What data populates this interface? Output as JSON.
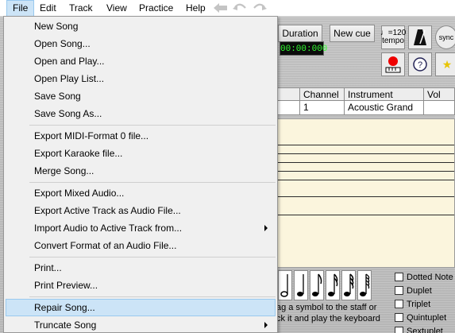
{
  "menubar": {
    "items": [
      {
        "label": "File"
      },
      {
        "label": "Edit"
      },
      {
        "label": "Track"
      },
      {
        "label": "View"
      },
      {
        "label": "Practice"
      },
      {
        "label": "Help"
      }
    ],
    "toolbar_icons": [
      "back-arrow-icon",
      "undo-icon",
      "redo-icon"
    ]
  },
  "app": {
    "duration_label": "Duration",
    "new_cue_label": "New cue",
    "time_display": "00:00:000",
    "tempo_value": "♩=120",
    "tempo_label": "tempo",
    "track_columns": [
      "Channel",
      "Instrument",
      "Vol"
    ],
    "track_row": {
      "channel": "1",
      "instrument": "Acoustic Grand",
      "vol": ""
    },
    "hint_line1": "ag a symbol to the staff or",
    "hint_line2": "ck it and play the keyboard",
    "note_options": [
      "Dotted Note",
      "Duplet",
      "Triplet",
      "Quintuplet",
      "Sextuplet"
    ]
  },
  "file_menu": {
    "items": [
      {
        "label": "New Song"
      },
      {
        "label": "Open Song..."
      },
      {
        "label": "Open and Play..."
      },
      {
        "label": "Open Play List..."
      },
      {
        "label": "Save Song"
      },
      {
        "label": "Save Song As..."
      },
      {
        "label": "Export MIDI-Format 0 file..."
      },
      {
        "label": "Export Karaoke file..."
      },
      {
        "label": "Merge Song..."
      },
      {
        "label": "Export Mixed Audio..."
      },
      {
        "label": "Export Active Track as Audio File..."
      },
      {
        "label": "Import Audio to Active Track from...",
        "submenu": true
      },
      {
        "label": "Convert Format of an Audio File..."
      },
      {
        "label": "Print..."
      },
      {
        "label": "Print Preview..."
      },
      {
        "label": "Repair Song...",
        "highlighted": true
      },
      {
        "label": "Truncate Song",
        "submenu": true
      }
    ]
  },
  "colors": {
    "highlight": "#cce4f7",
    "highlight_border": "#99c9ef",
    "staff_bg": "#fbf5dd",
    "led_text": "#33ff33"
  }
}
